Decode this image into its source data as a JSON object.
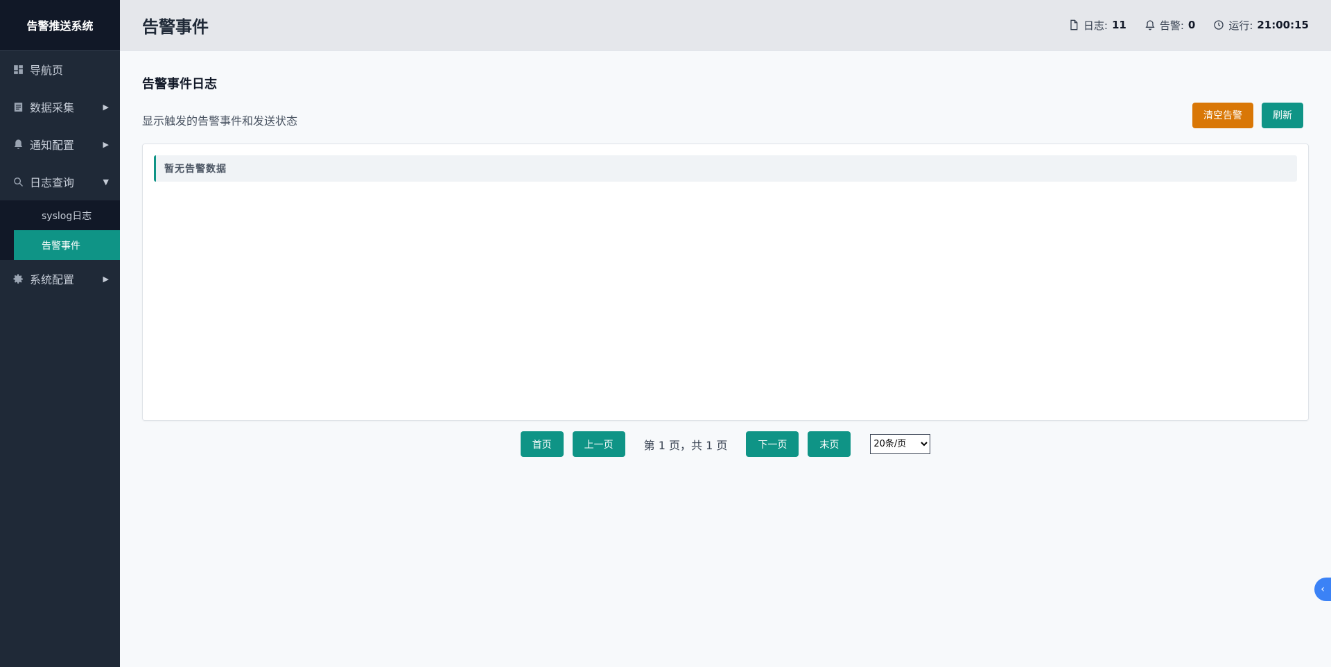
{
  "sidebar": {
    "brand": "告警推送系统",
    "items": [
      {
        "label": "导航页",
        "icon": "dashboard-icon",
        "arrow": ""
      },
      {
        "label": "数据采集",
        "icon": "document-icon",
        "arrow": "▶"
      },
      {
        "label": "通知配置",
        "icon": "bell-icon",
        "arrow": "▶"
      },
      {
        "label": "日志查询",
        "icon": "search-icon",
        "arrow": "▼"
      },
      {
        "label": "系统配置",
        "icon": "gear-icon",
        "arrow": "▶"
      }
    ],
    "sub_items": [
      {
        "label": "syslog日志"
      },
      {
        "label": "告警事件"
      }
    ]
  },
  "header": {
    "title": "告警事件",
    "log_label": "日志:",
    "log_value": "11",
    "alert_label": "告警:",
    "alert_value": "0",
    "runtime_label": "运行:",
    "runtime_value": "21:00:15"
  },
  "main": {
    "section_title": "告警事件日志",
    "description": "显示触发的告警事件和发送状态",
    "clear_button": "清空告警",
    "refresh_button": "刷新",
    "empty_message": "暂无告警数据"
  },
  "pager": {
    "first": "首页",
    "prev": "上一页",
    "info": "第 1 页，共 1 页",
    "next": "下一页",
    "last": "末页",
    "page_size": "20条/页"
  },
  "colors": {
    "accent": "#0f9486",
    "warning": "#d97706",
    "sidebar_bg": "#1f2937"
  }
}
